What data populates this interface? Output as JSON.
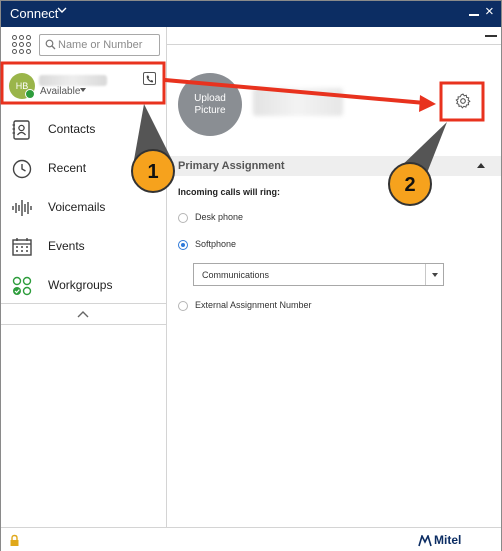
{
  "titlebar": {
    "app_title": "Connect",
    "minimize": "minimize",
    "close": "×"
  },
  "search": {
    "placeholder": "Name or Number"
  },
  "user": {
    "initials": "HB",
    "status": "Available"
  },
  "nav": [
    {
      "label": "Contacts",
      "icon": "contacts-icon"
    },
    {
      "label": "Recent",
      "icon": "clock-icon"
    },
    {
      "label": "Voicemails",
      "icon": "voicemail-icon"
    },
    {
      "label": "Events",
      "icon": "calendar-icon"
    },
    {
      "label": "Workgroups",
      "icon": "workgroups-icon"
    }
  ],
  "profile": {
    "upload_line1": "Upload",
    "upload_line2": "Picture"
  },
  "assignment": {
    "section_title": "Primary Assignment",
    "ring_label": "Incoming calls will ring:",
    "options": [
      "Desk phone",
      "Softphone",
      "External Assignment Number"
    ],
    "selected_option": "Softphone",
    "dropdown_value": "Communications"
  },
  "footer": {
    "brand": "Mitel"
  },
  "annotations": {
    "callout_1": "1",
    "callout_2": "2"
  },
  "colors": {
    "titlebar": "#0c2d63",
    "highlight_red": "#e8321e",
    "callout_fill": "#f6a21d",
    "callout_pointer": "#555555",
    "presence_green": "#2e9d3c",
    "radio_blue": "#2f7ad9"
  }
}
